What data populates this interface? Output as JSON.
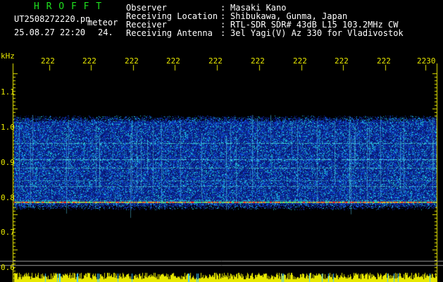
{
  "header": {
    "title": "H R O F F T",
    "filename": "UT2508272220.pn",
    "meteor_label": "meteor",
    "datetime": "25.08.27 22:20",
    "count": "24.",
    "fields": [
      {
        "label": "Observer",
        "sep": ":",
        "value": "Masaki Kano"
      },
      {
        "label": "Receiving Location",
        "sep": ":",
        "value": "Shibukawa, Gunma, Japan"
      },
      {
        "label": "Receiver",
        "sep": ":",
        "value": "RTL-SDR SDR# 43dB L15 103.2MHz CW"
      },
      {
        "label": "Receiving Antenna",
        "sep": ":",
        "value": "3el Yagi(V) Az 330 for Vladivostok"
      }
    ]
  },
  "axes": {
    "y_unit": "kHz",
    "y_ticks": [
      "1.1",
      "1.0",
      "0.9",
      "0.8",
      "0.7",
      "0.6"
    ],
    "x_ticks": [
      "222",
      "222",
      "222",
      "222",
      "222",
      "222",
      "222",
      "222",
      "222",
      "2230"
    ]
  },
  "colors": {
    "background": "#000000",
    "title": "#1fe01f",
    "labels": "#e8e800",
    "text": "#ffffff"
  }
}
